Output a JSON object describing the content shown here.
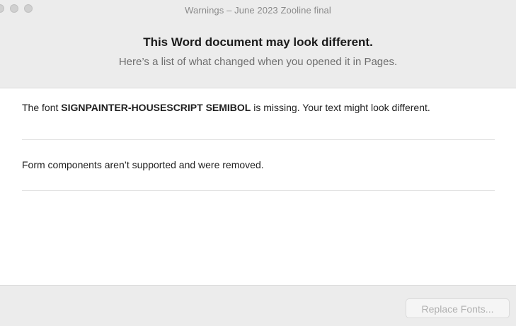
{
  "window": {
    "title": "Warnings – June 2023 Zooline final"
  },
  "header": {
    "title": "This Word document may look different.",
    "subtitle": "Here’s a list of what changed when you opened it in Pages."
  },
  "warnings": [
    {
      "prefix": "The font ",
      "font_name": "SIGNPAINTER-HOUSESCRIPT SEMIBOL",
      "suffix": " is missing. Your text might look different."
    },
    {
      "text": "Form components aren’t supported and were removed."
    }
  ],
  "footer": {
    "replace_fonts_label": "Replace Fonts...",
    "replace_fonts_enabled": false
  },
  "colors": {
    "chrome_background": "#ececec",
    "disabled_text": "#b0b0b0"
  }
}
